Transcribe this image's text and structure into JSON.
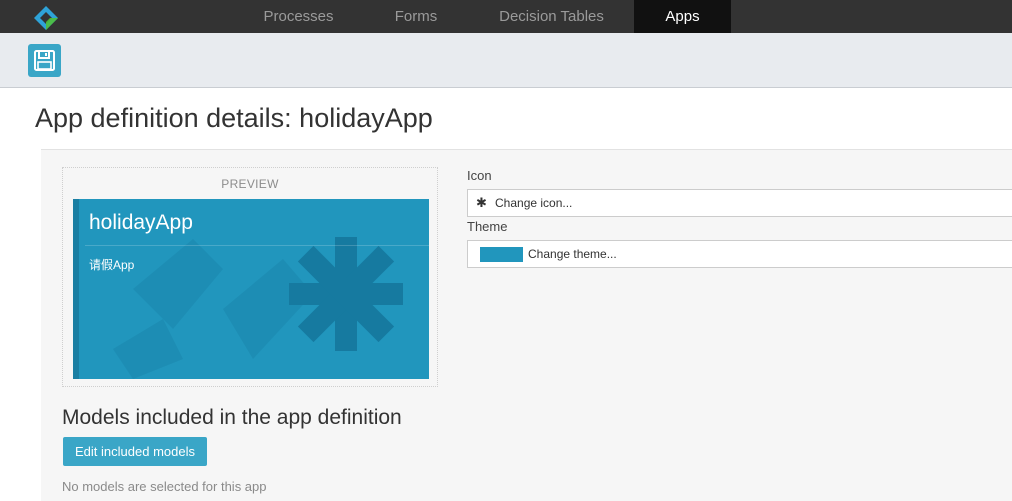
{
  "nav": {
    "items": [
      {
        "label": "Processes",
        "active": false
      },
      {
        "label": "Forms",
        "active": false
      },
      {
        "label": "Decision Tables",
        "active": false
      },
      {
        "label": "Apps",
        "active": true
      }
    ]
  },
  "toolbar": {
    "save_icon": "save-icon"
  },
  "page": {
    "title": "App definition details: holidayApp"
  },
  "preview": {
    "label": "PREVIEW",
    "app_name": "holidayApp",
    "app_description": "请假App",
    "theme_color": "#2196bd",
    "icon": "asterisk-icon"
  },
  "form": {
    "icon_label": "Icon",
    "icon_button": "Change icon...",
    "theme_label": "Theme",
    "theme_button": "Change theme..."
  },
  "models": {
    "title": "Models included in the app definition",
    "edit_button": "Edit included models",
    "empty_message": "No models are selected for this app"
  }
}
